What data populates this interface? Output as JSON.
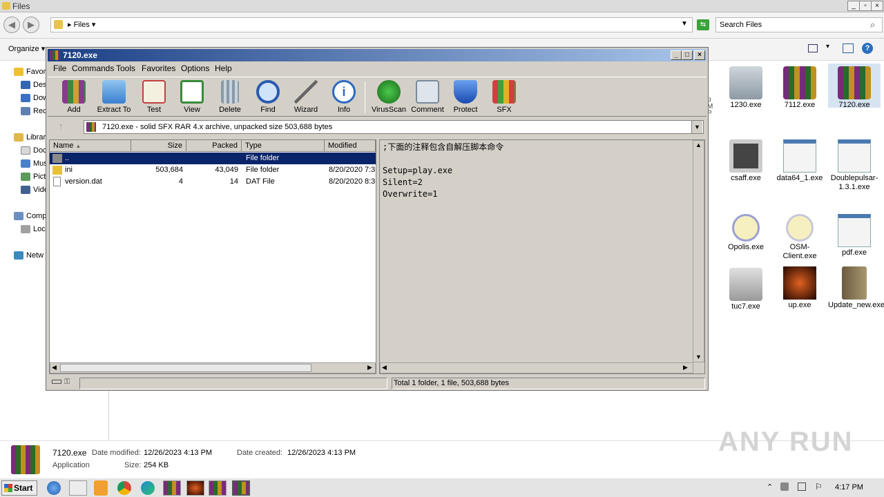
{
  "explorer": {
    "title": "Files",
    "address": "Files",
    "search_placeholder": "Search Files",
    "organize_label": "Organize",
    "nav_items": [
      "Favor",
      "Des",
      "Dow",
      "Rec",
      "Librar",
      "Doc",
      "Mus",
      "Pict",
      "Vide",
      "Comp",
      "Loc",
      "Netw"
    ],
    "right_col_text": "p\nM\nP\n."
  },
  "rar": {
    "title": "7120.exe",
    "menu": [
      "File",
      "Commands",
      "Tools",
      "Favorites",
      "Options",
      "Help"
    ],
    "tools": [
      "Add",
      "Extract To",
      "Test",
      "View",
      "Delete",
      "Find",
      "Wizard",
      "Info",
      "VirusScan",
      "Comment",
      "Protect",
      "SFX"
    ],
    "path": "7120.exe - solid SFX RAR 4.x archive, unpacked size 503,688 bytes",
    "columns": [
      "Name",
      "Size",
      "Packed",
      "Type",
      "Modified"
    ],
    "rows": [
      {
        "name": "..",
        "size": "",
        "packed": "",
        "type": "File folder",
        "modified": ""
      },
      {
        "name": "ini",
        "size": "503,684",
        "packed": "43,049",
        "type": "File folder",
        "modified": "8/20/2020 7:3"
      },
      {
        "name": "version.dat",
        "size": "4",
        "packed": "14",
        "type": "DAT File",
        "modified": "8/20/2020 8:3"
      }
    ],
    "comment_lines": [
      ";下面的注释包含自解压脚本命令",
      "",
      "Setup=play.exe",
      "Silent=2",
      "Overwrite=1"
    ],
    "status": "Total 1 folder, 1 file, 503,688 bytes"
  },
  "desktop_icons": [
    {
      "label": "1230.exe",
      "icon": "disc-installer-icon"
    },
    {
      "label": "7112.exe",
      "icon": "winrar-icon"
    },
    {
      "label": "7120.exe",
      "icon": "winrar-icon"
    },
    {
      "label": "csaff.exe",
      "icon": "gift-icon"
    },
    {
      "label": "data64_1.exe",
      "icon": "window-app-icon"
    },
    {
      "label": "Doublepulsar-1.3.1.exe",
      "icon": "window-app-icon"
    },
    {
      "label": "Opolis.exe",
      "icon": "warning-icon"
    },
    {
      "label": "OSM-Client.exe",
      "icon": "warning-icon"
    },
    {
      "label": "pdf.exe",
      "icon": "window-app-icon"
    },
    {
      "label": "tuc7.exe",
      "icon": "music-folder-icon"
    },
    {
      "label": "up.exe",
      "icon": "game-logo-icon"
    },
    {
      "label": "Update_new.exe",
      "icon": "box-icon"
    }
  ],
  "details": {
    "name": "7120.exe",
    "modified_label": "Date modified:",
    "modified": "12/26/2023 4:13 PM",
    "created_label": "Date created:",
    "created": "12/26/2023 4:13 PM",
    "type": "Application",
    "size_label": "Size:",
    "size": "254 KB"
  },
  "taskbar": {
    "start": "Start",
    "clock": "4:17 PM"
  },
  "watermark": "ANY RUN",
  "colors": {
    "rar_title": "#1b3f85",
    "selection": "#0a246a",
    "winrar_face": "#d4d0c8"
  }
}
